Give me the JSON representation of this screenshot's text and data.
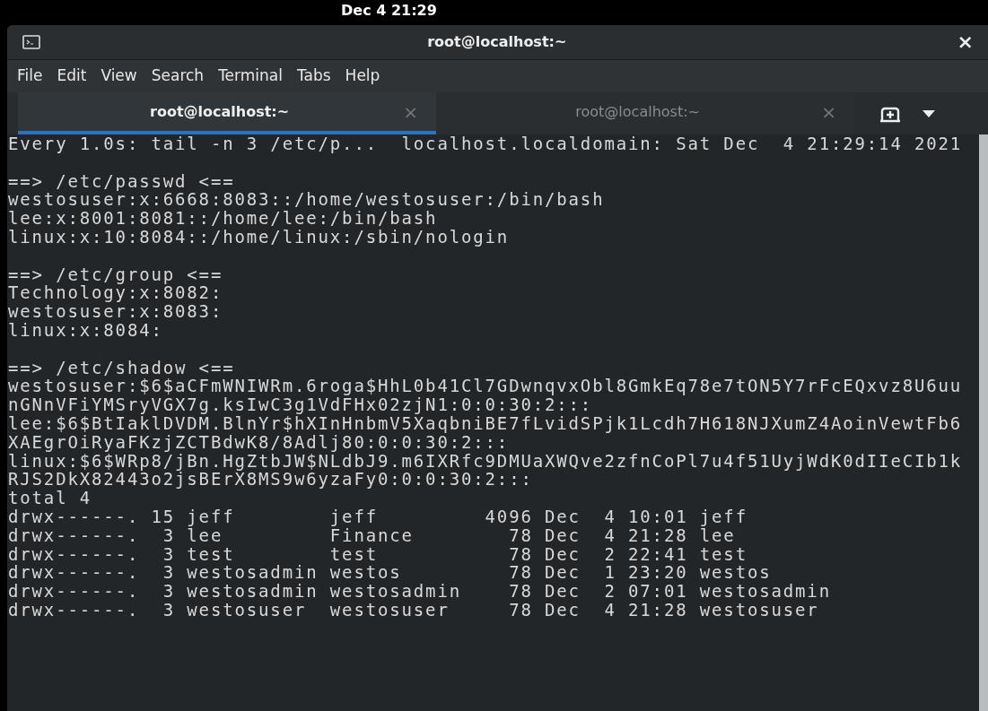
{
  "top_bar": {
    "clock": "Dec 4  21:29"
  },
  "window": {
    "title": "root@localhost:~",
    "close": "×"
  },
  "menu": [
    "File",
    "Edit",
    "View",
    "Search",
    "Terminal",
    "Tabs",
    "Help"
  ],
  "tabs": [
    {
      "label": "root@localhost:~",
      "close": "×",
      "selected": true
    },
    {
      "label": "root@localhost:~",
      "close": "×",
      "selected": false
    }
  ],
  "terminal": {
    "status_line": "Every 1.0s: tail -n 3 /etc/p...  localhost.localdomain: Sat Dec  4 21:29:14 2021",
    "sections": [
      {
        "heading": "==> /etc/passwd <==",
        "lines": [
          "westosuser:x:6668:8083::/home/westosuser:/bin/bash",
          "lee:x:8001:8081::/home/lee:/bin/bash",
          "linux:x:10:8084::/home/linux:/sbin/nologin"
        ]
      },
      {
        "heading": "==> /etc/group <==",
        "lines": [
          "Technology:x:8082:",
          "westosuser:x:8083:",
          "linux:x:8084:"
        ]
      },
      {
        "heading": "==> /etc/shadow <==",
        "lines": [
          "westosuser:$6$aCFmWNIWRm.6roga$HhL0b41Cl7GDwnqvxObl8GmkEq78e7tON5Y7rFcEQxvz8U6uu",
          "nGNnVFiYMSryVGX7g.ksIwC3g1VdFHx02zjN1:0:0:30:2:::",
          "lee:$6$BtIaklDVDM.BlnYr$hXInHnbmV5XaqbniBE7fLvidSPjk1Lcdh7H618NJXumZ4AoinVewtFb6",
          "XAEgrOiRyaFKzjZCTBdwK8/8Adlj80:0:0:30:2:::",
          "linux:$6$WRp8/jBn.HgZtbJW$NLdbJ9.m6IXRfc9DMUaXWQve2zfnCoPl7u4f51UyjWdK0dIIeCIb1k",
          "RJS2DkX82443o2jsBErX8MS9w6yzaFy0:0:0:30:2:::"
        ]
      }
    ],
    "listing": {
      "total": "total 4",
      "rows": [
        "drwx------. 15 jeff        jeff         4096 Dec  4 10:01 jeff",
        "drwx------.  3 lee         Finance        78 Dec  4 21:28 lee",
        "drwx------.  3 test        test           78 Dec  2 22:41 test",
        "drwx------.  3 westosadmin westos         78 Dec  1 23:20 westos",
        "drwx------.  3 westosadmin westosadmin    78 Dec  2 07:01 westosadmin",
        "drwx------.  3 westosuser  westosuser     78 Dec  4 21:28 westosuser"
      ]
    }
  }
}
